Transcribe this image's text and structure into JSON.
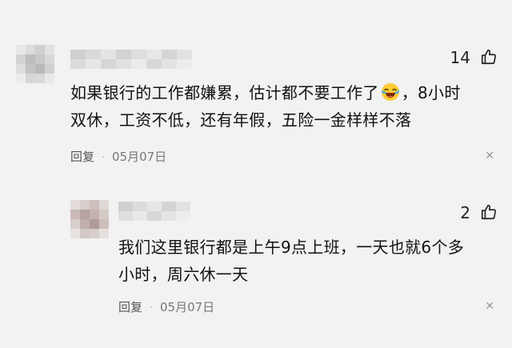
{
  "colors": {
    "background": "#f2f2f2",
    "text": "#111111",
    "meta": "#777777"
  },
  "comment": {
    "like_count": "14",
    "text_line1": "如果银行的工作都嫌累，估计都不要工作了",
    "emoji": "laughing-crying-emoji",
    "text_line1_tail": "，8小时",
    "text_line2": "双休，工资不低，还有年假，五险一金样样不落",
    "reply_label": "回复",
    "date": "05月07日"
  },
  "reply": {
    "like_count": "2",
    "text_line1": "我们这里银行都是上午9点上班，一天也就6个多",
    "text_line2": "小时，周六休一天",
    "reply_label": "回复",
    "date": "05月07日"
  }
}
